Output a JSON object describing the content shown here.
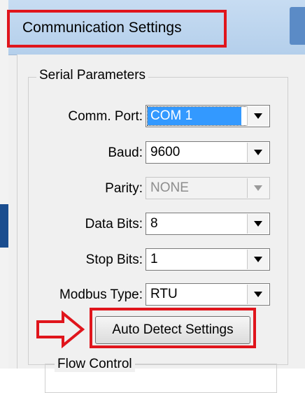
{
  "dialog": {
    "title": "Communication Settings"
  },
  "serial_parameters": {
    "group_title": "Serial Parameters",
    "fields": [
      {
        "label": "Comm. Port:",
        "value": "COM 1",
        "state": "selected"
      },
      {
        "label": "Baud:",
        "value": "9600",
        "state": "normal"
      },
      {
        "label": "Parity:",
        "value": "NONE",
        "state": "disabled"
      },
      {
        "label": "Data Bits:",
        "value": "8",
        "state": "normal"
      },
      {
        "label": "Stop Bits:",
        "value": "1",
        "state": "normal"
      },
      {
        "label": "Modbus Type:",
        "value": "RTU",
        "state": "normal"
      }
    ]
  },
  "actions": {
    "auto_detect_label": "Auto Detect Settings"
  },
  "flow_control": {
    "group_title": "Flow Control"
  },
  "annotations": {
    "highlight_color": "#e0151c"
  }
}
